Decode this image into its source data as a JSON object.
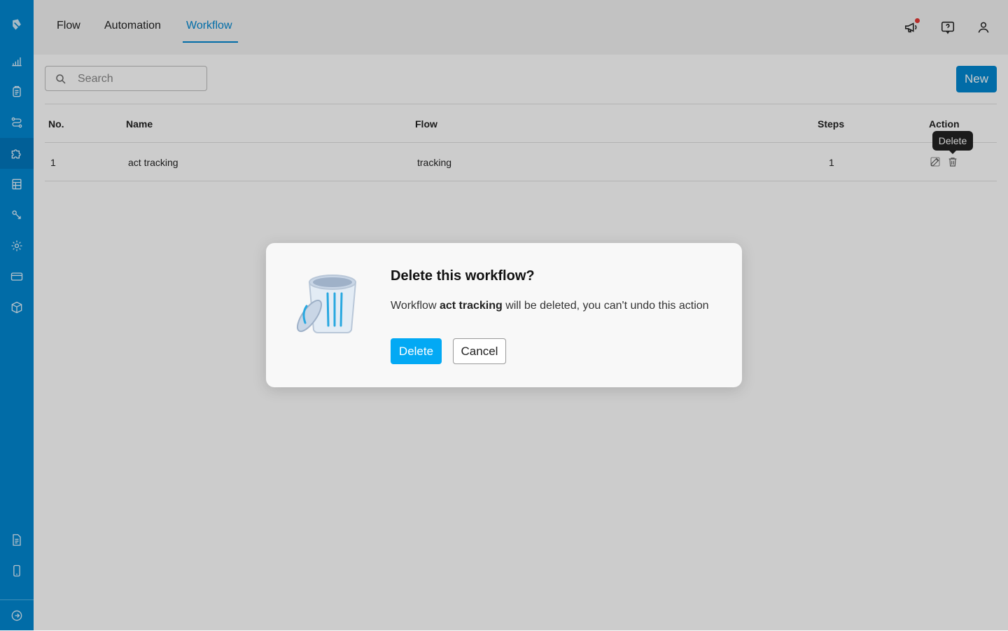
{
  "sidebar": {
    "items": [
      {
        "icon": "logo-icon"
      },
      {
        "icon": "bar-chart-icon"
      },
      {
        "icon": "clipboard-icon"
      },
      {
        "icon": "flow-icon"
      },
      {
        "icon": "puzzle-icon",
        "active": true
      },
      {
        "icon": "table-icon"
      },
      {
        "icon": "filter-icon"
      },
      {
        "icon": "gear-icon"
      },
      {
        "icon": "credit-card-icon"
      },
      {
        "icon": "box-icon"
      },
      {
        "icon": "document-icon"
      },
      {
        "icon": "mobile-icon"
      },
      {
        "icon": "arrow-right-circle-icon"
      }
    ],
    "colors": {
      "background": "#0288d1",
      "active": "#0277bd"
    }
  },
  "header": {
    "tabs": [
      {
        "label": "Flow"
      },
      {
        "label": "Automation"
      },
      {
        "label": "Workflow",
        "active": true
      }
    ],
    "icons": [
      "megaphone-icon",
      "help-chat-icon",
      "user-icon"
    ],
    "notification": true
  },
  "toolbar": {
    "search_placeholder": "Search",
    "new_label": "New"
  },
  "table": {
    "columns": [
      "No.",
      "Name",
      "Flow",
      "Steps",
      "Action"
    ],
    "rows": [
      {
        "no": "1",
        "name": "act tracking",
        "flow": "tracking",
        "steps": "1"
      }
    ],
    "action_icons": [
      "edit-icon",
      "trash-icon"
    ],
    "tooltip": "Delete"
  },
  "dialog": {
    "title": "Delete this workflow?",
    "message_prefix": "Workflow ",
    "message_name": "act tracking",
    "message_suffix": " will be deleted, you can't undo this action",
    "delete_label": "Delete",
    "cancel_label": "Cancel",
    "illustration": "trash-can-illustration"
  },
  "colors": {
    "accent": "#0288d1",
    "dialog_button": "#03a9f4"
  }
}
